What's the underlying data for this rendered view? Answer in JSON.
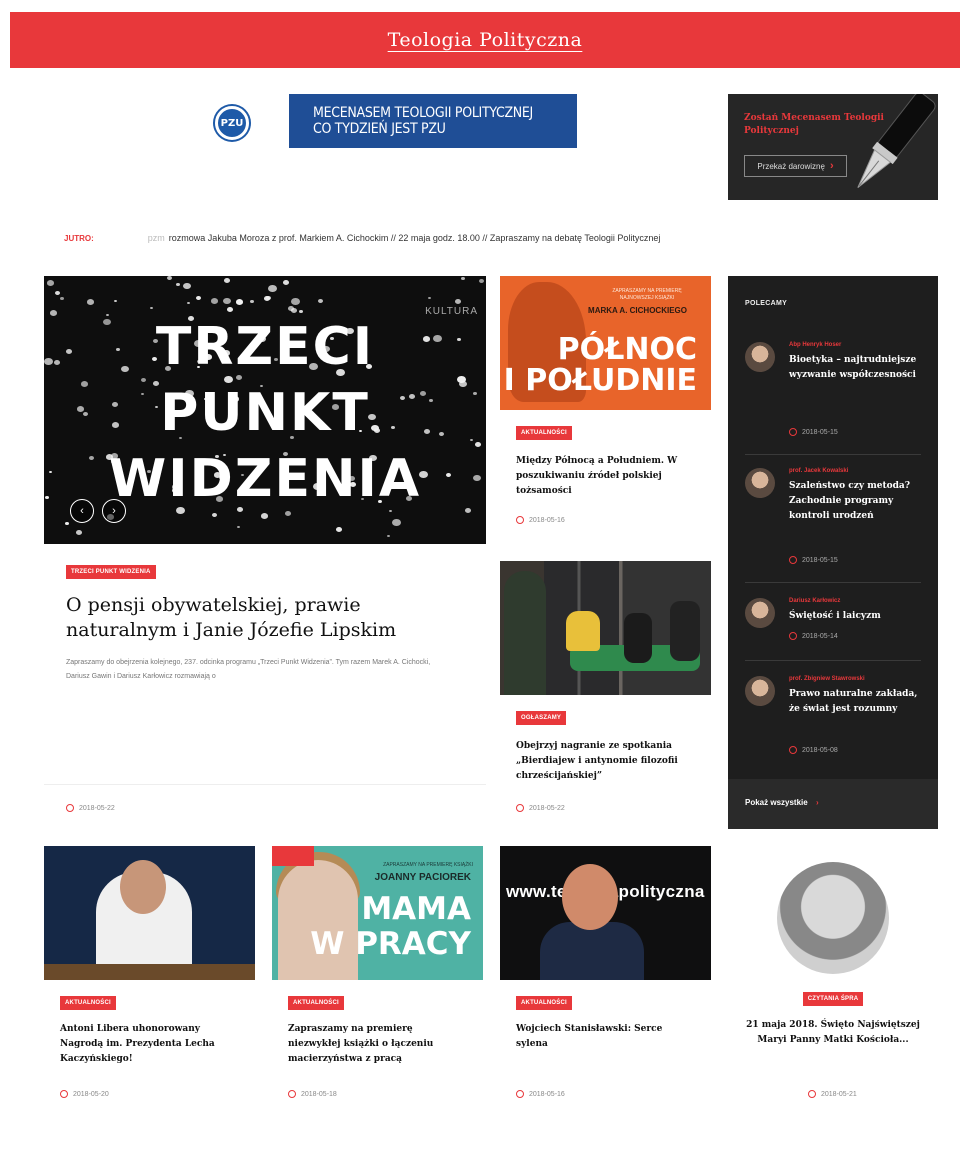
{
  "header": {
    "logo_text": "Teologia Polityczna",
    "brand_color": "#e8383b"
  },
  "sponsor": {
    "logo_text": "PZU",
    "banner_text": "MECENASEM TEOLOGII POLITYCZNEJ CO TYDZIEŃ JEST PZU"
  },
  "patron": {
    "title": "Zostań Mecenasem Teologii Politycznej",
    "button_label": "Przekaż darowiznę",
    "icon": "fountain-pen-icon"
  },
  "ticker": {
    "label": "JUTRO:",
    "faded_text": "pzm",
    "text": "rozmowa Jakuba Moroza z prof. Markiem A. Cichockim // 22 maja godz. 18.00 // Zapraszamy na debatę Teologii Politycznej"
  },
  "featured": {
    "image_text_lines": [
      "TRZECI",
      "PUNKT",
      "WIDZENIA"
    ],
    "image_brand": "KULTURA",
    "tag": "TRZECI PUNKT WIDZENIA",
    "title": "O pensji obywatelskiej, prawie naturalnym i Janie Józefie Lipskim",
    "description": "Zapraszamy do obejrzenia kolejnego, 237. odcinka programu „Trzeci Punkt Widzenia”. Tym razem Marek A. Cichocki, Dariusz Gawin i Dariusz Karłowicz rozmawiają o",
    "date": "2018-05-22"
  },
  "cards": [
    {
      "thumb_top": "ZAPRASZAMY NA PREMIERĘ NAJNOWSZEJ KSIĄŻKI",
      "thumb_author": "MARKA A. CICHOCKIEGO",
      "thumb_big": [
        "PÓŁNOC",
        "I POŁUDNIE"
      ],
      "tag": "AKTUALNOŚCI",
      "title": "Między Północą a Południem. W poszukiwaniu źródeł polskiej tożsamości",
      "date": "2018-05-16"
    },
    {
      "tag": "OGŁASZAMY",
      "title": "Obejrzyj nagranie ze spotkania „Bierdiajew i antynomie filozofii chrześcijańskiej”",
      "date": "2018-05-22"
    }
  ],
  "sidebar": {
    "heading": "POLECAMY",
    "items": [
      {
        "author": "Abp Henryk Hoser",
        "title": "Bioetyka – najtrudniejsze wyzwanie współczesności",
        "date": "2018-05-15"
      },
      {
        "author": "prof. Jacek Kowalski",
        "title": "Szaleństwo czy metoda? Zachodnie programy kontroli urodzeń",
        "date": "2018-05-15"
      },
      {
        "author": "Dariusz Karłowicz",
        "title": "Świętość i laicyzm",
        "date": "2018-05-14"
      },
      {
        "author": "prof. Zbigniew Stawrowski",
        "title": "Prawo naturalne zakłada, że świat jest rozumny",
        "date": "2018-05-08"
      }
    ],
    "show_all": "Pokaż wszystkie"
  },
  "bottom_row": [
    {
      "tag": "AKTUALNOŚCI",
      "title": "Antoni Libera uhonorowany Nagrodą im. Prezydenta Lecha Kaczyńskiego!",
      "date": "2018-05-20"
    },
    {
      "thumb_top": "ZAPRASZAMY NA PREMIERĘ KSIĄŻKI",
      "thumb_author": "JOANNY PACIOREK",
      "thumb_big": [
        "MAMA",
        "W PRACY"
      ],
      "tag": "AKTUALNOŚCI",
      "title": "Zapraszamy na premierę niezwykłej książki o łączeniu macierzyństwa z pracą",
      "date": "2018-05-18"
    },
    {
      "thumb_text": "www.teologiapolityczna",
      "tag": "AKTUALNOŚCI",
      "title": "Wojciech Stanisławski: Serce sylena",
      "date": "2018-05-16"
    },
    {
      "tag": "CZYTANIA ŚPRA",
      "title": "21 maja 2018. Święto Najświętszej Maryi Panny Matki Kościoła...",
      "date": "2018-05-21"
    }
  ]
}
